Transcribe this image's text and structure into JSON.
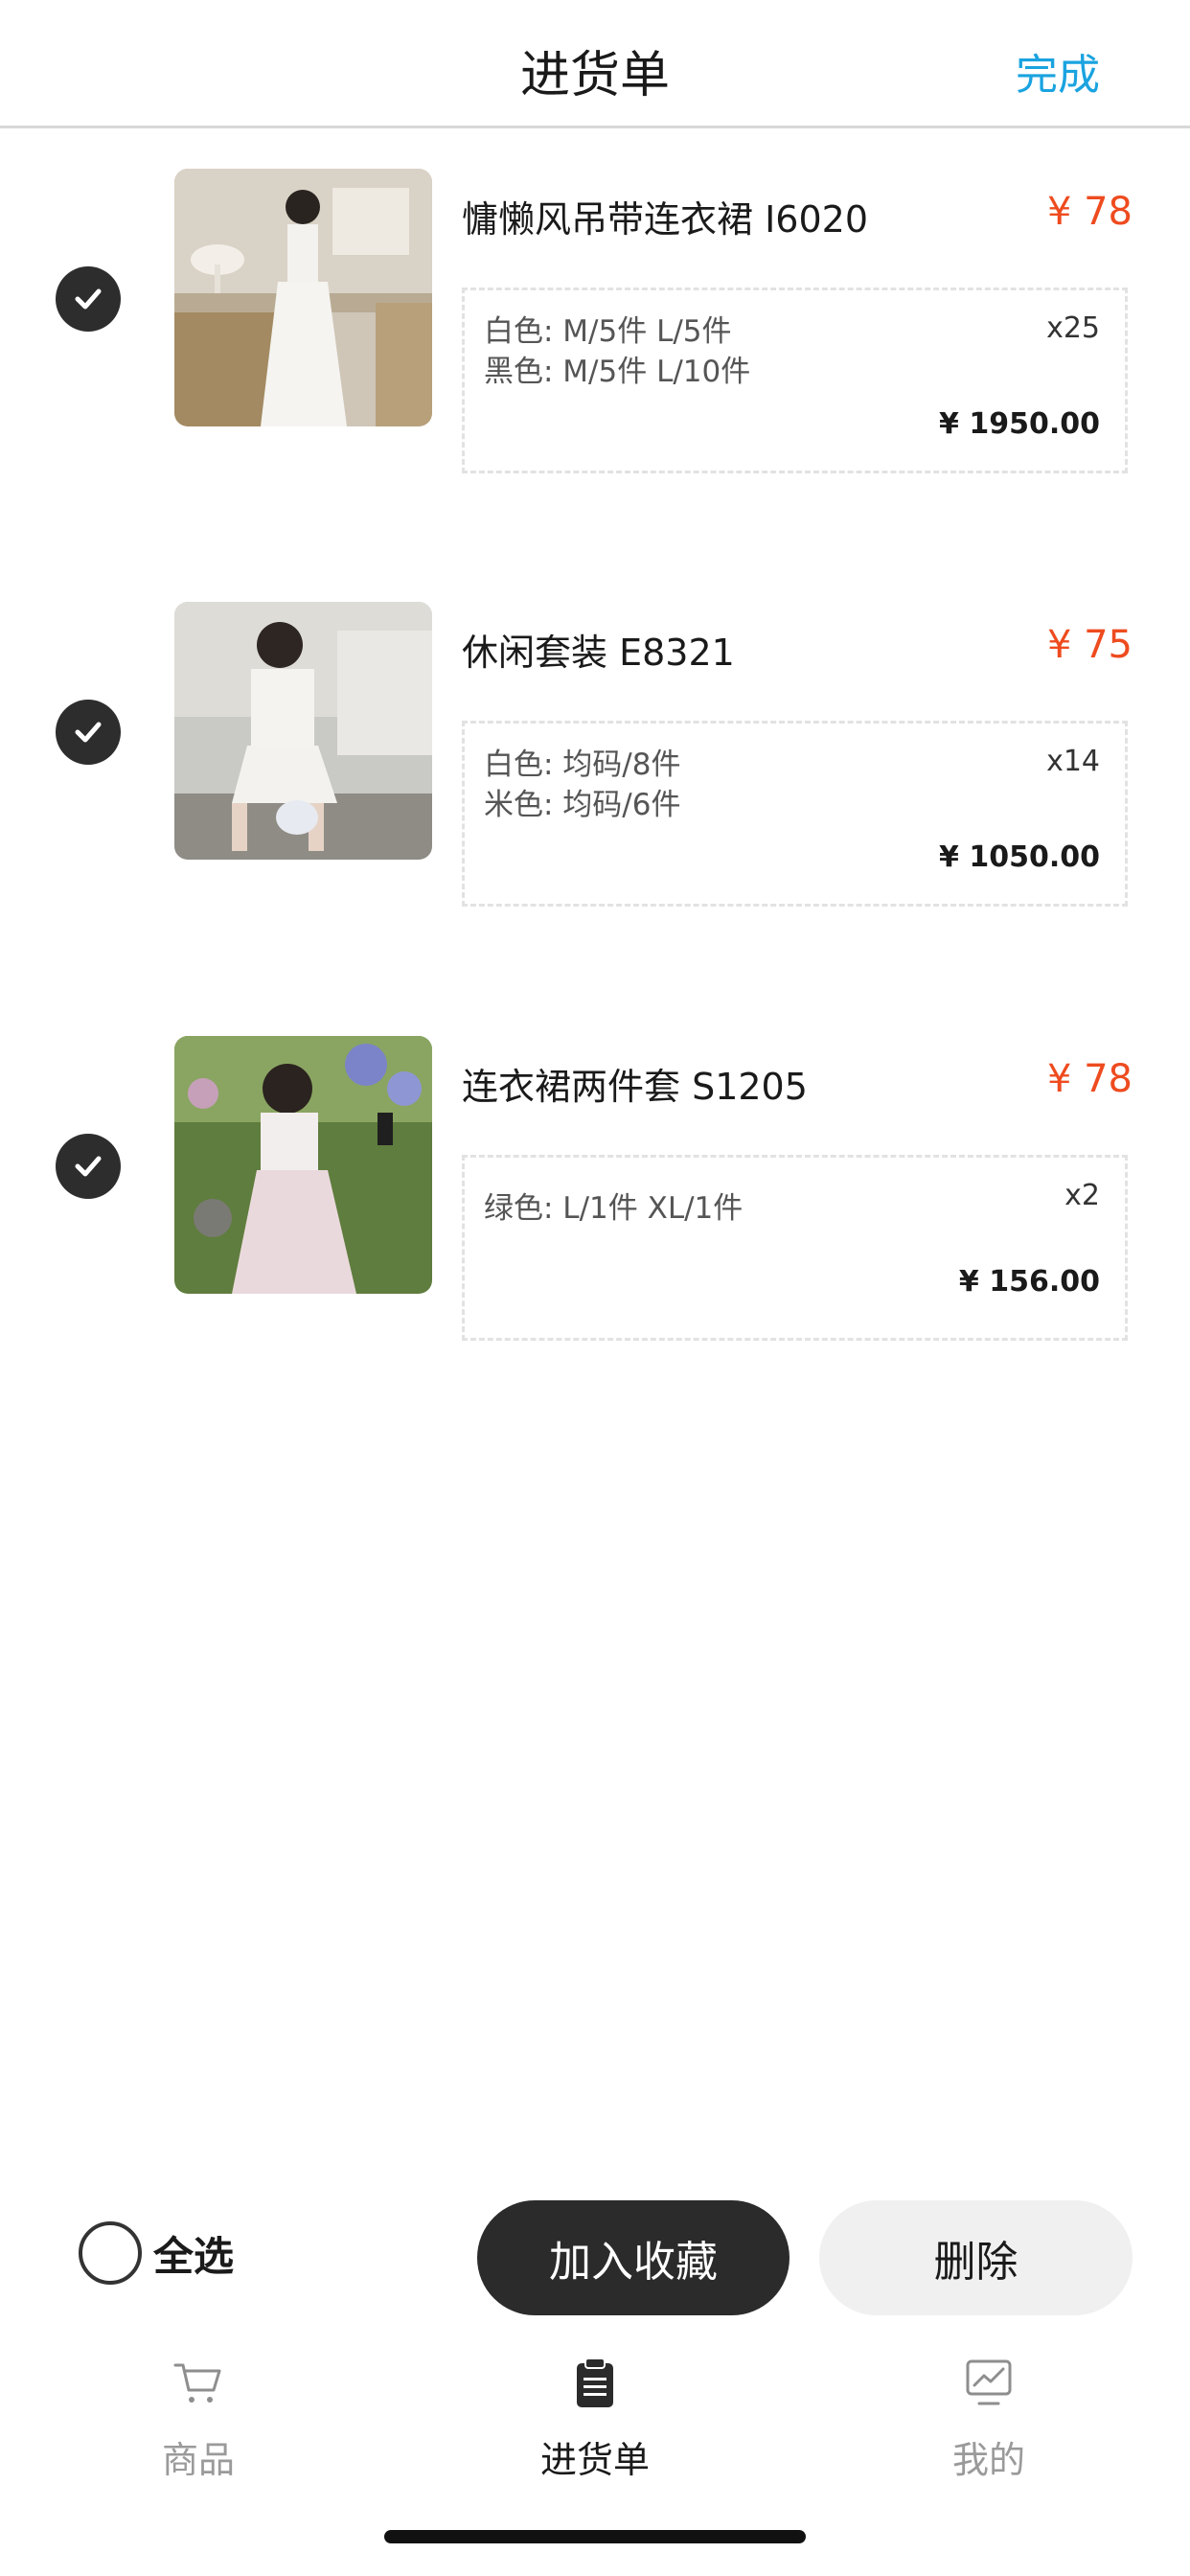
{
  "header": {
    "title": "进货单",
    "done_label": "完成"
  },
  "items": [
    {
      "title": "慵懒风吊带连衣裙  I6020",
      "price": "¥ 78",
      "specs": [
        "白色: M/5件 L/5件",
        "黑色: M/5件 L/10件"
      ],
      "qty": "x25",
      "total": "¥ 1950.00",
      "checked": true
    },
    {
      "title": "休闲套装  E8321",
      "price": "¥ 75",
      "specs": [
        "白色: 均码/8件",
        "米色: 均码/6件"
      ],
      "qty": "x14",
      "total": "¥ 1050.00",
      "checked": true
    },
    {
      "title": "连衣裙两件套  S1205",
      "price": "¥ 78",
      "specs": [
        "绿色: L/1件 XL/1件"
      ],
      "qty": "x2",
      "total": "¥ 156.00",
      "checked": true
    }
  ],
  "actions": {
    "select_all_label": "全选",
    "favorite_label": "加入收藏",
    "delete_label": "删除"
  },
  "tabbar": [
    {
      "label": "商品",
      "icon": "cart-icon",
      "active": false
    },
    {
      "label": "进货单",
      "icon": "clipboard-icon",
      "active": true
    },
    {
      "label": "我的",
      "icon": "chart-icon",
      "active": false
    }
  ],
  "colors": {
    "accent": "#1aa3e0",
    "price": "#ee4b1f",
    "dark": "#2b2b2b"
  }
}
